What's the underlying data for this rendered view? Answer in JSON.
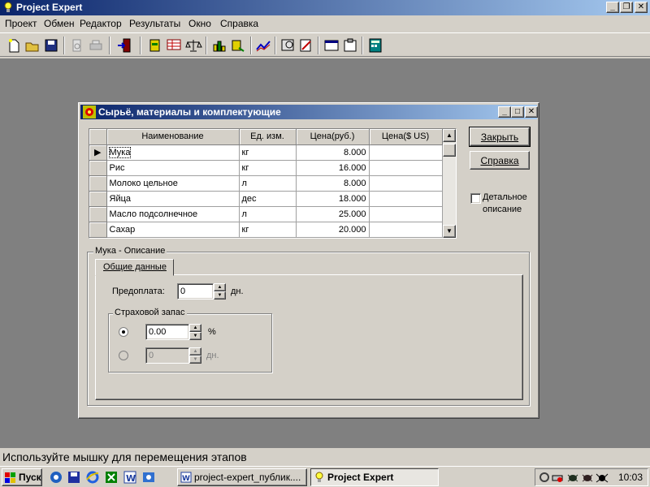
{
  "app": {
    "title": "Project Expert",
    "menu": [
      "Проект",
      "Обмен",
      "Редактор",
      "Результаты",
      "Окно",
      "Справка"
    ]
  },
  "dialog": {
    "title": "Сырьё, материалы и комплектующие",
    "columns": [
      "Наименование",
      "Ед. изм.",
      "Цена(руб.)",
      "Цена($ US)"
    ],
    "rows": [
      {
        "name": "Мука",
        "unit": "кг",
        "price_rub": "8.000",
        "price_usd": ""
      },
      {
        "name": "Рис",
        "unit": "кг",
        "price_rub": "16.000",
        "price_usd": ""
      },
      {
        "name": "Молоко цельное",
        "unit": "л",
        "price_rub": "8.000",
        "price_usd": ""
      },
      {
        "name": "Яйца",
        "unit": "дес",
        "price_rub": "18.000",
        "price_usd": ""
      },
      {
        "name": "Масло подсолнечное",
        "unit": "л",
        "price_rub": "25.000",
        "price_usd": ""
      },
      {
        "name": "Сахар",
        "unit": "кг",
        "price_rub": "20.000",
        "price_usd": ""
      }
    ],
    "close_label": "Закрыть",
    "help_label": "Справка",
    "detail_label_1": "Детальное",
    "detail_label_2": "описание",
    "desc_group": "Мука - Описание",
    "tab_general": "Общие данные",
    "prepay_label": "Предоплата:",
    "prepay_value": "0",
    "prepay_unit": "дн.",
    "stock_group": "Страховой запас",
    "stock_percent_value": "0.00",
    "stock_percent_unit": "%",
    "stock_days_value": "0",
    "stock_days_unit": "дн."
  },
  "status": {
    "text": "Используйте мышку для перемещения этапов"
  },
  "taskbar": {
    "start": "Пуск",
    "tasks": [
      "project-expert_публик....",
      "Project Expert"
    ],
    "clock": "10:03"
  }
}
